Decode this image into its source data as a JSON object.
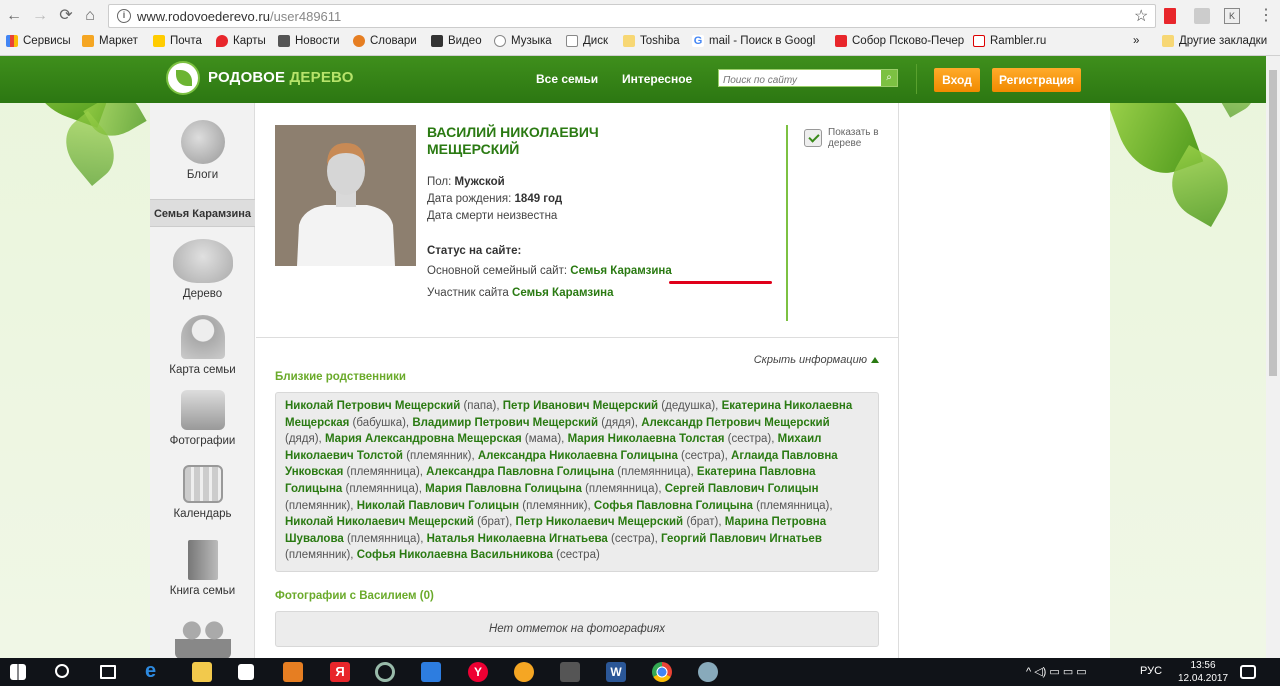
{
  "browser": {
    "url_host": "www.rodovoederevo.ru",
    "url_path": "/user489611",
    "bookmarks": [
      "Сервисы",
      "Маркет",
      "Почта",
      "Карты",
      "Новости",
      "Словари",
      "Видео",
      "Музыка",
      "Диск",
      "Toshiba",
      "mail - Поиск в Googl",
      "Собор Псково-Печер",
      "Rambler.ru",
      "Другие закладки"
    ],
    "overflow": "»"
  },
  "header": {
    "logo_part1": "РОДОВОЕ",
    "logo_part2": "ДЕРЕВО",
    "nav_all_families": "Все семьи",
    "nav_interesting": "Интересное",
    "search_placeholder": "Поиск по сайту",
    "login": "Вход",
    "register": "Регистрация"
  },
  "sidebar": {
    "blogs": "Блоги",
    "family_tab": "Семья Карамзина",
    "tree": "Дерево",
    "map": "Карта семьи",
    "photos": "Фотографии",
    "calendar": "Календарь",
    "book": "Книга семьи"
  },
  "profile": {
    "name_line1": "ВАСИЛИЙ НИКОЛАЕВИЧ",
    "name_line2": "МЕЩЕРСКИЙ",
    "sex_label": "Пол:",
    "sex_value": "Мужской",
    "birth_label": "Дата рождения:",
    "birth_value": "1849 год",
    "death": "Дата смерти неизвестна",
    "status_title": "Статус на сайте:",
    "main_site_label": "Основной семейный сайт:",
    "main_site_value": "Семья Карамзина",
    "member_label": "Участник сайта",
    "member_value": "Семья Карамзина",
    "show_in_tree": "Показать в дереве"
  },
  "relatives": {
    "hide_info": "Скрыть информацию",
    "title": "Близкие родственники",
    "items": [
      {
        "name": "Николай Петрович Мещерский",
        "rel": " (папа), "
      },
      {
        "name": "Петр Иванович Мещерский",
        "rel": " (дедушка), "
      },
      {
        "name": "Екатерина Николаевна Мещерская",
        "rel": " (бабушка), "
      },
      {
        "name": "Владимир Петрович Мещерский",
        "rel": " (дядя), "
      },
      {
        "name": "Александр Петрович Мещерский",
        "rel": " (дядя), "
      },
      {
        "name": "Мария Александровна Мещерская",
        "rel": " (мама), "
      },
      {
        "name": "Мария Николаевна Толстая",
        "rel": " (сестра), "
      },
      {
        "name": "Михаил Николаевич Толстой",
        "rel": " (племянник), "
      },
      {
        "name": "Александра Николаевна Голицына",
        "rel": " (сестра), "
      },
      {
        "name": "Аглаида Павловна Унковская",
        "rel": " (племянница), "
      },
      {
        "name": "Александра Павловна Голицына",
        "rel": " (племянница), "
      },
      {
        "name": "Екатерина Павловна Голицына",
        "rel": " (племянница), "
      },
      {
        "name": "Мария Павловна Голицына",
        "rel": " (племянница), "
      },
      {
        "name": "Сергей Павлович Голицын",
        "rel": " (племянник), "
      },
      {
        "name": "Николай Павлович Голицын",
        "rel": " (племянник), "
      },
      {
        "name": "Софья Павловна Голицына",
        "rel": " (племянница), "
      },
      {
        "name": "Николай Николаевич Мещерский",
        "rel": " (брат), "
      },
      {
        "name": "Петр Николаевич Мещерский",
        "rel": " (брат), "
      },
      {
        "name": "Марина Петровна Шувалова",
        "rel": " (племянница), "
      },
      {
        "name": "Наталья Николаевна Игнатьева",
        "rel": " (сестра), "
      },
      {
        "name": "Георгий Павлович Игнатьев",
        "rel": " (племянник), "
      },
      {
        "name": "Софья Николаевна Васильникова",
        "rel": " (сестра)"
      }
    ]
  },
  "photos_section": {
    "title": "Фотографии с Василием (0)",
    "empty": "Нет отметок на фотографиях"
  },
  "taskbar": {
    "lang": "РУС",
    "time": "13:56",
    "date": "12.04.2017"
  },
  "colors": {
    "brand_green": "#2a7a12",
    "header_green": "#3f8f1c",
    "button_orange": "#f18a00",
    "underline_red": "#e0001a"
  }
}
